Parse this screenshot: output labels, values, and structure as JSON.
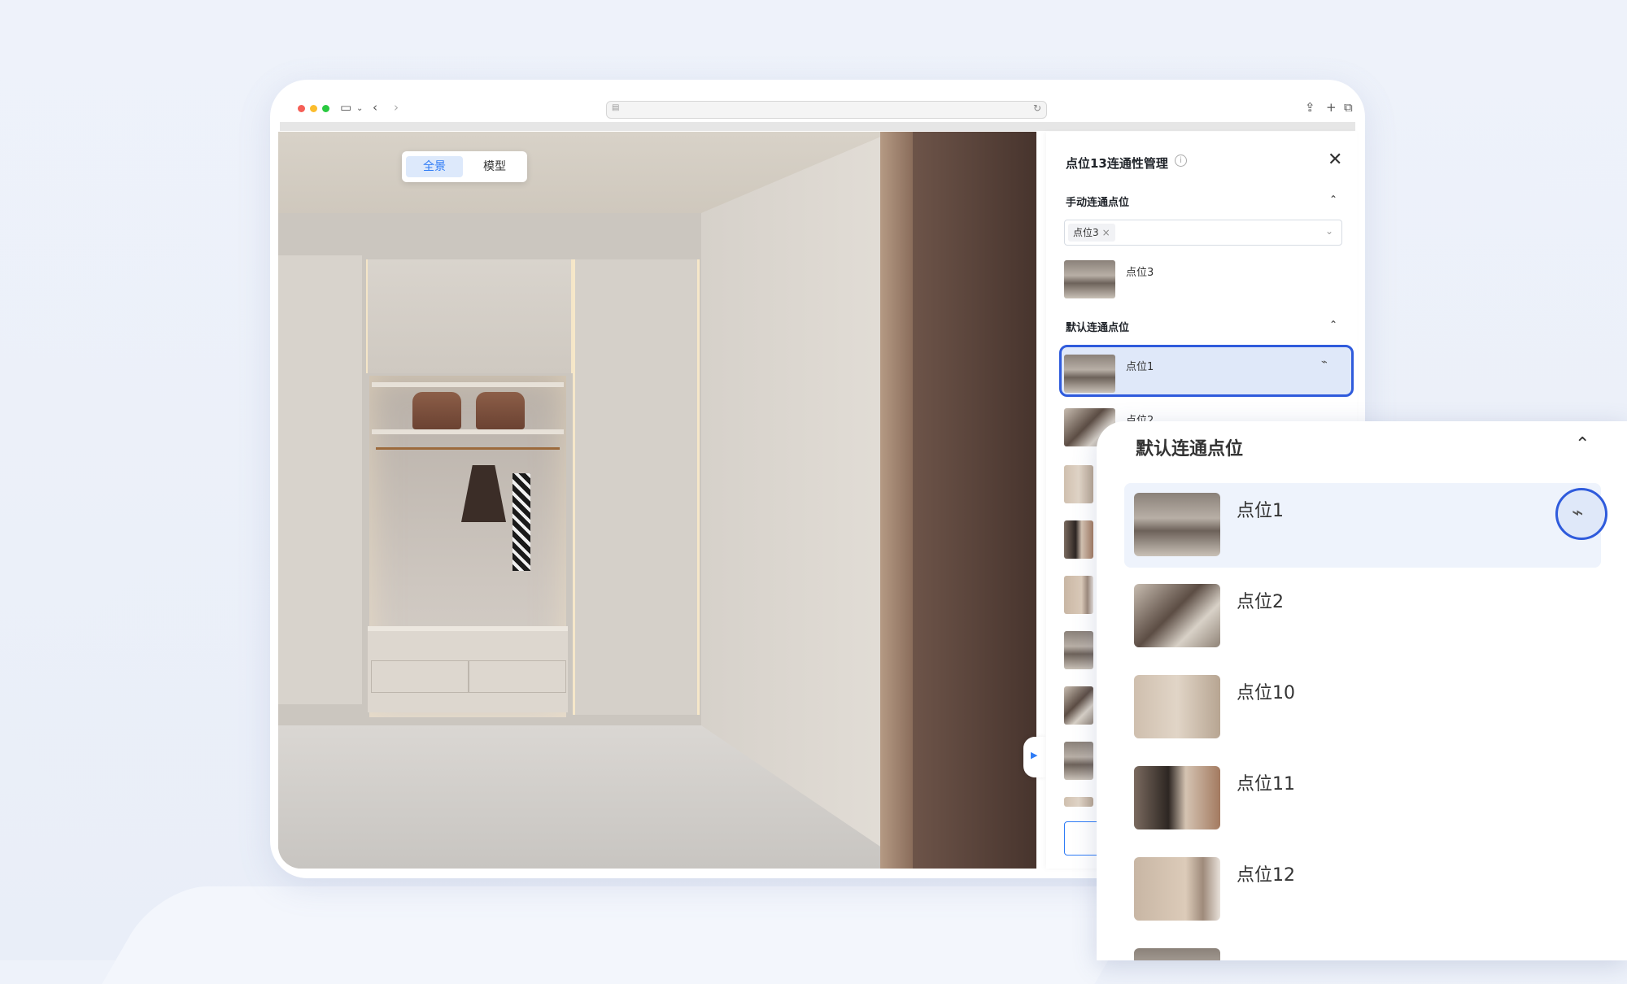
{
  "viewer": {
    "toggle": [
      {
        "label": "全景",
        "active": true
      },
      {
        "label": "模型",
        "active": false
      }
    ]
  },
  "panel": {
    "title": "点位13连通性管理",
    "info_icon": "info-icon",
    "close_icon": "close-icon",
    "manual_section": {
      "heading": "手动连通点位",
      "selected_tag": "点位3",
      "items": [
        {
          "label": "点位3"
        }
      ]
    },
    "default_section": {
      "heading": "默认连通点位",
      "items": [
        {
          "label": "点位1"
        },
        {
          "label": "点位2"
        }
      ]
    }
  },
  "zoom": {
    "heading": "默认连通点位",
    "items": [
      {
        "label": "点位1"
      },
      {
        "label": "点位2"
      },
      {
        "label": "点位10"
      },
      {
        "label": "点位11"
      },
      {
        "label": "点位12"
      }
    ],
    "pin_icon": "unlink-icon"
  },
  "colors": {
    "accent": "#2f7cf6",
    "highlight_border": "#2f5bdc",
    "highlight_bg": "#dfe8f9"
  }
}
